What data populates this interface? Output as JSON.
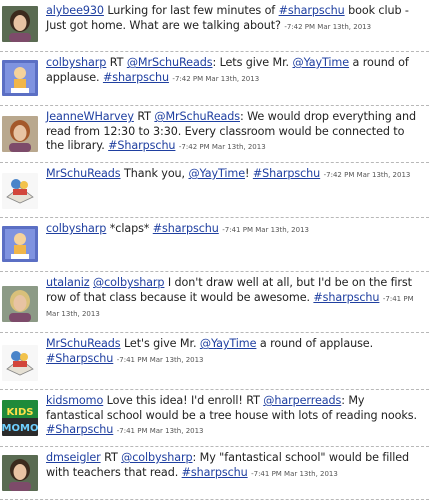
{
  "tweets": [
    {
      "avatar": "woman-photo-icon",
      "segments": [
        {
          "t": "alybee930",
          "link": true
        },
        {
          "t": " Lurking for last few minutes of "
        },
        {
          "t": "#sharpschu",
          "link": true
        },
        {
          "t": " book club - Just got home. What are we talking about? "
        },
        {
          "t": "-7:42 PM Mar 13th, 2013",
          "ts": true
        }
      ]
    },
    {
      "avatar": "cartoon-character-icon",
      "segments": [
        {
          "t": "colbysharp",
          "link": true
        },
        {
          "t": " RT "
        },
        {
          "t": "@MrSchuReads",
          "link": true
        },
        {
          "t": ": Lets give Mr. "
        },
        {
          "t": "@YayTime",
          "link": true
        },
        {
          "t": " a round of applause. "
        },
        {
          "t": "#sharpschu",
          "link": true
        },
        {
          "t": " "
        },
        {
          "t": "-7:42 PM Mar 13th, 2013",
          "ts": true
        }
      ]
    },
    {
      "avatar": "woman-photo-icon",
      "segments": [
        {
          "t": "JeanneWHarvey",
          "link": true
        },
        {
          "t": " RT "
        },
        {
          "t": "@MrSchuReads",
          "link": true
        },
        {
          "t": ": We would drop everything and read from 12:30 to 3:30. Every classroom would be connected to the library. "
        },
        {
          "t": "#Sharpschu",
          "link": true
        },
        {
          "t": " "
        },
        {
          "t": "-7:42 PM Mar 13th, 2013",
          "ts": true
        }
      ]
    },
    {
      "avatar": "book-character-icon",
      "segments": [
        {
          "t": "MrSchuReads",
          "link": true
        },
        {
          "t": " Thank you, "
        },
        {
          "t": "@YayTime",
          "link": true
        },
        {
          "t": "! "
        },
        {
          "t": "#Sharpschu",
          "link": true
        },
        {
          "t": " "
        },
        {
          "t": "-7:42 PM Mar 13th, 2013",
          "ts": true
        }
      ]
    },
    {
      "avatar": "cartoon-character-icon",
      "segments": [
        {
          "t": "colbysharp",
          "link": true
        },
        {
          "t": " *claps* "
        },
        {
          "t": "#sharpschu",
          "link": true
        },
        {
          "t": " "
        },
        {
          "t": "-7:41 PM Mar 13th, 2013",
          "ts": true
        }
      ]
    },
    {
      "avatar": "woman-photo-icon",
      "segments": [
        {
          "t": "utalaniz",
          "link": true
        },
        {
          "t": " "
        },
        {
          "t": "@colbysharp",
          "link": true
        },
        {
          "t": " I don't draw well at all, but I'd be on the first row of that class because it would be awesome. "
        },
        {
          "t": "#sharpschu",
          "link": true
        },
        {
          "t": " "
        },
        {
          "t": "-7:41 PM Mar 13th, 2013",
          "ts": true
        }
      ]
    },
    {
      "avatar": "book-character-icon",
      "segments": [
        {
          "t": "MrSchuReads",
          "link": true
        },
        {
          "t": " Let's give Mr. "
        },
        {
          "t": "@YayTime",
          "link": true
        },
        {
          "t": " a round of applause. "
        },
        {
          "t": "#Sharpschu",
          "link": true
        },
        {
          "t": " "
        },
        {
          "t": "-7:41 PM Mar 13th, 2013",
          "ts": true
        }
      ]
    },
    {
      "avatar": "kids-momo-logo-icon",
      "avatar_text": [
        "KIDS",
        "MOMO"
      ],
      "segments": [
        {
          "t": "kidsmomo",
          "link": true
        },
        {
          "t": " Love this idea! I'd enroll! RT "
        },
        {
          "t": "@harperreads",
          "link": true
        },
        {
          "t": ": My fantastical school would be a tree house with lots of reading nooks. "
        },
        {
          "t": "#Sharpschu",
          "link": true
        },
        {
          "t": " "
        },
        {
          "t": "-7:41 PM Mar 13th, 2013",
          "ts": true
        }
      ]
    },
    {
      "avatar": "woman-photo-icon",
      "segments": [
        {
          "t": "dmseigler",
          "link": true
        },
        {
          "t": " RT "
        },
        {
          "t": "@colbysharp",
          "link": true
        },
        {
          "t": ": My \"fantastical school\" would be filled with teachers that read. "
        },
        {
          "t": "#sharpschu",
          "link": true
        },
        {
          "t": " "
        },
        {
          "t": "-7:41 PM Mar 13th, 2013",
          "ts": true
        }
      ]
    }
  ]
}
